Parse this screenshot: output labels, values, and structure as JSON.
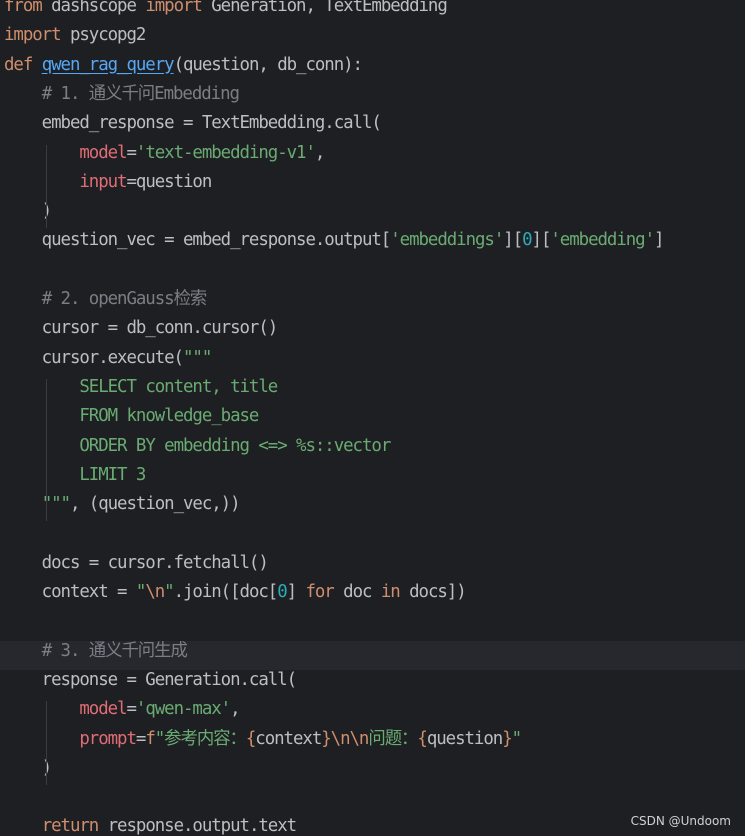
{
  "editor": {
    "current_line": 22,
    "lines": [
      [
        [
          "kw",
          "from"
        ],
        [
          "p",
          " dashscope "
        ],
        [
          "kw",
          "import"
        ],
        [
          "p",
          " Generation, TextEmbedding"
        ]
      ],
      [
        [
          "kw",
          "import"
        ],
        [
          "p",
          " psycopg2"
        ]
      ],
      [
        [
          "kw",
          "def"
        ],
        [
          "p",
          " "
        ],
        [
          "def",
          "qwen_rag_query"
        ],
        [
          "p",
          "(question, db_conn):"
        ]
      ],
      [
        [
          "p",
          "    "
        ],
        [
          "cm",
          "# 1. 通义千问Embedding"
        ]
      ],
      [
        [
          "p",
          "    embed_response = TextEmbedding.call("
        ]
      ],
      [
        [
          "p",
          "        "
        ],
        [
          "pk",
          "model"
        ],
        [
          "p",
          "="
        ],
        [
          "str",
          "'text-embedding-v1'"
        ],
        [
          "p",
          ","
        ]
      ],
      [
        [
          "p",
          "        "
        ],
        [
          "pk",
          "input"
        ],
        [
          "p",
          "=question"
        ]
      ],
      [
        [
          "p",
          "    )"
        ]
      ],
      [
        [
          "p",
          "    question_vec = embed_response.output["
        ],
        [
          "str",
          "'embeddings'"
        ],
        [
          "p",
          "]["
        ],
        [
          "num",
          "0"
        ],
        [
          "p",
          "]["
        ],
        [
          "str",
          "'embedding'"
        ],
        [
          "p",
          "]"
        ]
      ],
      [],
      [
        [
          "p",
          "    "
        ],
        [
          "cm",
          "# 2. openGauss检索"
        ]
      ],
      [
        [
          "p",
          "    cursor = db_conn.cursor()"
        ]
      ],
      [
        [
          "p",
          "    cursor.execute("
        ],
        [
          "str",
          "\"\"\""
        ]
      ],
      [
        [
          "p",
          "        "
        ],
        [
          "str",
          "SELECT content, title"
        ]
      ],
      [
        [
          "p",
          "        "
        ],
        [
          "str",
          "FROM knowledge_base"
        ]
      ],
      [
        [
          "p",
          "        "
        ],
        [
          "str",
          "ORDER BY embedding <=> %s::vector"
        ]
      ],
      [
        [
          "p",
          "        "
        ],
        [
          "str",
          "LIMIT 3"
        ]
      ],
      [
        [
          "p",
          "    "
        ],
        [
          "str",
          "\"\"\""
        ],
        [
          "p",
          ", (question_vec,))"
        ]
      ],
      [],
      [
        [
          "p",
          "    docs = cursor.fetchall()"
        ]
      ],
      [
        [
          "p",
          "    context = "
        ],
        [
          "str",
          "\""
        ],
        [
          "esc",
          "\\n"
        ],
        [
          "str",
          "\""
        ],
        [
          "p",
          ".join([doc["
        ],
        [
          "num",
          "0"
        ],
        [
          "p",
          "] "
        ],
        [
          "kw",
          "for"
        ],
        [
          "p",
          " doc "
        ],
        [
          "kw",
          "in"
        ],
        [
          "p",
          " docs])"
        ]
      ],
      [],
      [
        [
          "p",
          "    "
        ],
        [
          "cm",
          "# 3. 通义千问生成"
        ]
      ],
      [
        [
          "p",
          "    response = Generation.call("
        ]
      ],
      [
        [
          "p",
          "        "
        ],
        [
          "pk",
          "model"
        ],
        [
          "p",
          "="
        ],
        [
          "str",
          "'qwen-max'"
        ],
        [
          "p",
          ","
        ]
      ],
      [
        [
          "p",
          "        "
        ],
        [
          "pk",
          "prompt"
        ],
        [
          "p",
          "="
        ],
        [
          "kw",
          "f"
        ],
        [
          "str",
          "\"参考内容："
        ],
        [
          "fbr",
          "{"
        ],
        [
          "p",
          "context"
        ],
        [
          "fbr",
          "}"
        ],
        [
          "esc",
          "\\n\\n"
        ],
        [
          "str",
          "问题："
        ],
        [
          "fbr",
          "{"
        ],
        [
          "p",
          "question"
        ],
        [
          "fbr",
          "}"
        ],
        [
          "str",
          "\""
        ]
      ],
      [
        [
          "p",
          "    )"
        ]
      ],
      [],
      [
        [
          "p",
          "    "
        ],
        [
          "kw",
          "return"
        ],
        [
          "p",
          " response.output.text"
        ]
      ]
    ]
  },
  "watermark": "CSDN @Undoom"
}
